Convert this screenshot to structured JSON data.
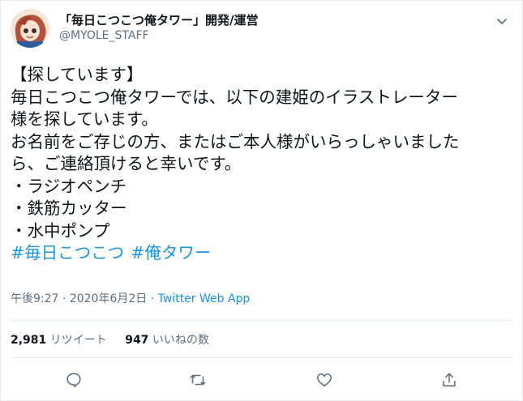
{
  "author": {
    "display_name": "「毎日こつこつ俺タワー」開発/運営",
    "handle": "@MYOLE_STAFF",
    "avatar_icon": "character-avatar",
    "more_icon": "chevron-down-icon"
  },
  "tweet": {
    "lines": [
      "【探しています】",
      "毎日こつこつ俺タワーでは、以下の建姫のイラストレーター",
      "様を探しています。",
      "お名前をご存じの方、またはご本人様がいらっしゃいました",
      "ら、ご連絡頂けると幸いです。",
      "・ラジオペンチ",
      "・鉄筋カッター",
      "・水中ポンプ"
    ],
    "hashtags": [
      "#毎日こつこつ",
      "#俺タワー"
    ]
  },
  "meta": {
    "time": "午後9:27",
    "date": "2020年6月2日",
    "separator": "·",
    "source": "Twitter Web App"
  },
  "stats": {
    "retweets_count": "2,981",
    "retweets_label": "リツイート",
    "likes_count": "947",
    "likes_label": "いいねの数"
  },
  "actions": {
    "reply_icon": "reply-icon",
    "retweet_icon": "retweet-icon",
    "like_icon": "heart-icon",
    "share_icon": "share-icon"
  },
  "colors": {
    "link": "#1b95e0",
    "muted": "#5b7083",
    "text": "#0f1419",
    "border": "#e6ecf0"
  }
}
